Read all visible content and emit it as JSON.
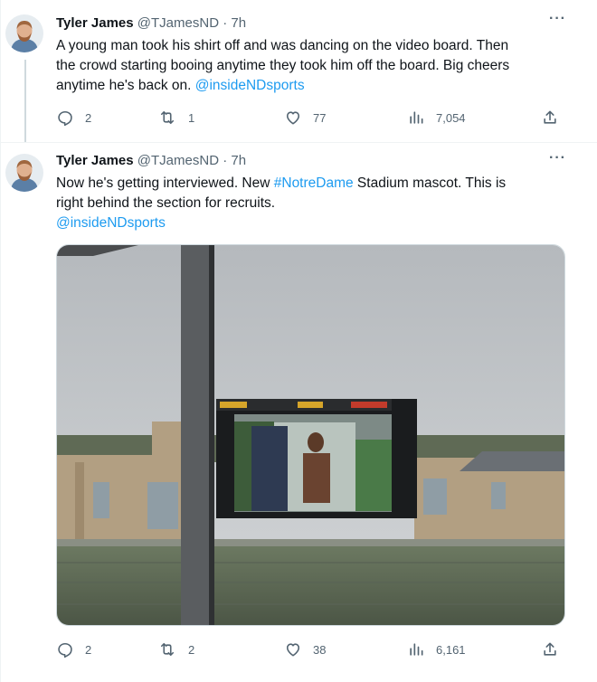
{
  "tweets": [
    {
      "author_name": "Tyler James",
      "handle": "@TJamesND",
      "separator": "·",
      "time": "7h",
      "text_lines": [
        "A young man took his shirt off and was dancing on the video board. Then",
        "the crowd starting booing anytime they took him off the board. Big cheers",
        "anytime he's back on. "
      ],
      "mention": "@insideNDsports",
      "more_label": "···",
      "stats": {
        "replies": "2",
        "reposts": "1",
        "likes": "77",
        "views": "7,054"
      }
    },
    {
      "author_name": "Tyler James",
      "handle": "@TJamesND",
      "separator": "·",
      "time": "7h",
      "text_before_hashtag": "Now he's getting interviewed. New ",
      "hashtag": "#NotreDame",
      "text_after_hashtag": " Stadium mascot. This is",
      "text_line2": "right behind the section for recruits.",
      "mention": "@insideNDsports",
      "more_label": "···",
      "stats": {
        "replies": "2",
        "reposts": "2",
        "likes": "38",
        "views": "6,161"
      }
    }
  ],
  "colors": {
    "link": "#1d9bf0",
    "text": "#0f1419",
    "muted": "#536471",
    "border": "#eff3f4"
  },
  "icons": [
    "reply-icon",
    "repost-icon",
    "like-icon",
    "views-icon",
    "share-icon",
    "more-icon"
  ]
}
